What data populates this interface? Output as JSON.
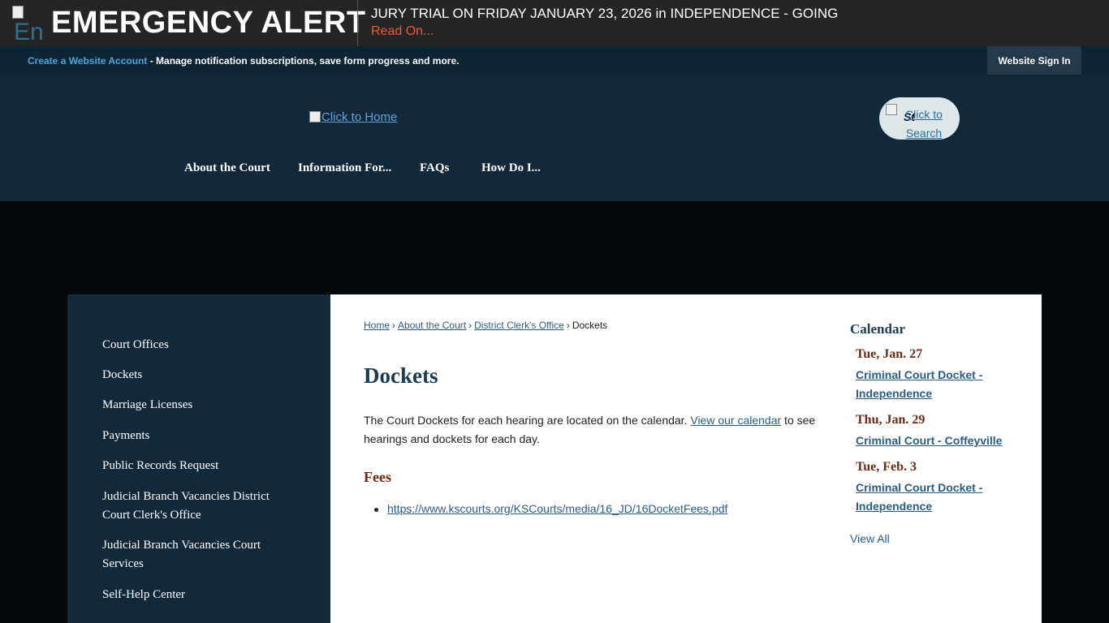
{
  "alert": {
    "icon_alt": "En",
    "title": "EMERGENCY ALERT",
    "message": "JURY TRIAL ON FRIDAY JANUARY 23, 2026 in INDEPENDENCE - GOING",
    "read_on": "Read On..."
  },
  "account_bar": {
    "create_link": "Create a Website Account",
    "description": " - Manage notification subscriptions, save form progress and more.",
    "sign_in": "Website Sign In"
  },
  "header": {
    "logo_alt": "Click to Home",
    "search_alt": "Click to Search",
    "search_icon_alt": "St",
    "nav": [
      "About the Court",
      "Information For...",
      "FAQs",
      "How Do I..."
    ]
  },
  "sidebar": {
    "items": [
      "Court Offices",
      "Dockets",
      "Marriage Licenses",
      "Payments",
      "Public Records Request",
      "Judicial Branch Vacancies District Court Clerk's Office",
      "Judicial Branch Vacancies Court Services",
      "Self-Help Center"
    ]
  },
  "breadcrumb": {
    "items": [
      "Home",
      "About the Court",
      "District Clerk's Office"
    ],
    "current": "Dockets",
    "separator": "›"
  },
  "content": {
    "title": "Dockets",
    "intro_before": "The Court Dockets for each hearing are located on the calendar. ",
    "intro_link": "View our calendar",
    "intro_after": " to see hearings and dockets for each day.",
    "fees_heading": "Fees",
    "fees_link": "https://www.kscourts.org/KSCourts/media/16_JD/16DocketFees.pdf"
  },
  "calendar": {
    "title": "Calendar",
    "events": [
      {
        "date": "Tue, Jan. 27",
        "title": "Criminal Court Docket - Independence"
      },
      {
        "date": "Thu, Jan. 29",
        "title": "Criminal Court - Coffeyville"
      },
      {
        "date": "Tue, Feb. 3",
        "title": "Criminal Court Docket - Independence"
      }
    ],
    "view_all": "View All"
  }
}
